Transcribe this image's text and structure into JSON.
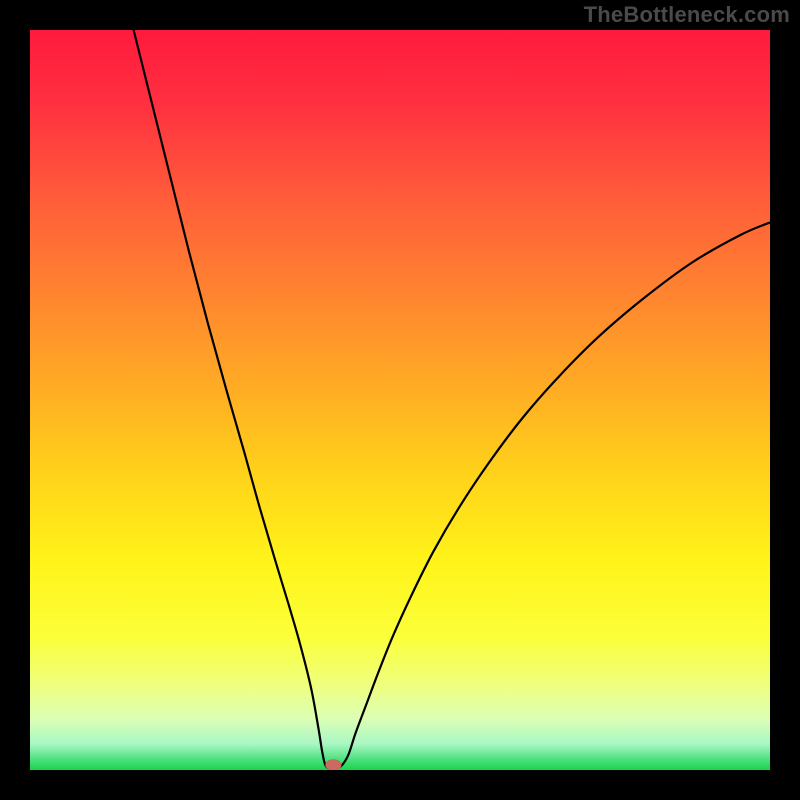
{
  "watermark_text": "TheBottleneck.com",
  "chart_data": {
    "type": "area",
    "title": "",
    "xlabel": "",
    "ylabel": "",
    "xlim": [
      0,
      100
    ],
    "ylim": [
      0,
      100
    ],
    "optimal_x": 41,
    "optimal_y": 0,
    "curve_description": "Bottleneck-percentage style V-curve: starts at x≈14,y≈100, drops steeply and near-linearly to a flat minimum at y≈0 around x≈39–42, then rises with decreasing slope to x=100,y≈73.",
    "curve_points": {
      "x": [
        14.0,
        16.5,
        19.0,
        21.5,
        24.0,
        26.5,
        29.0,
        31.0,
        33.0,
        35.0,
        36.5,
        38.0,
        39.0,
        39.5,
        40.0,
        41.0,
        42.0,
        43.0,
        44.0,
        45.5,
        47.0,
        49.0,
        51.5,
        54.5,
        58.0,
        62.0,
        66.5,
        71.5,
        77.0,
        83.0,
        89.5,
        96.0,
        100.0
      ],
      "y": [
        100.0,
        90.0,
        80.0,
        70.0,
        60.5,
        51.5,
        42.8,
        35.6,
        28.8,
        22.2,
        17.0,
        11.0,
        5.5,
        2.4,
        0.5,
        0.2,
        0.5,
        2.0,
        5.0,
        9.0,
        13.0,
        18.0,
        23.5,
        29.5,
        35.5,
        41.5,
        47.5,
        53.2,
        58.7,
        63.8,
        68.6,
        72.3,
        74.0
      ]
    },
    "background_gradient": {
      "type": "vertical",
      "stops": [
        {
          "offset": 0.0,
          "color": "#ff1a3d"
        },
        {
          "offset": 0.1,
          "color": "#ff3040"
        },
        {
          "offset": 0.22,
          "color": "#ff5a3a"
        },
        {
          "offset": 0.35,
          "color": "#ff8230"
        },
        {
          "offset": 0.48,
          "color": "#ffab24"
        },
        {
          "offset": 0.6,
          "color": "#ffd21a"
        },
        {
          "offset": 0.72,
          "color": "#fff41a"
        },
        {
          "offset": 0.82,
          "color": "#fbff3a"
        },
        {
          "offset": 0.88,
          "color": "#f0ff78"
        },
        {
          "offset": 0.93,
          "color": "#dcffb4"
        },
        {
          "offset": 0.965,
          "color": "#a8f7c4"
        },
        {
          "offset": 0.985,
          "color": "#4fe27f"
        },
        {
          "offset": 1.0,
          "color": "#1bd24e"
        }
      ]
    }
  }
}
